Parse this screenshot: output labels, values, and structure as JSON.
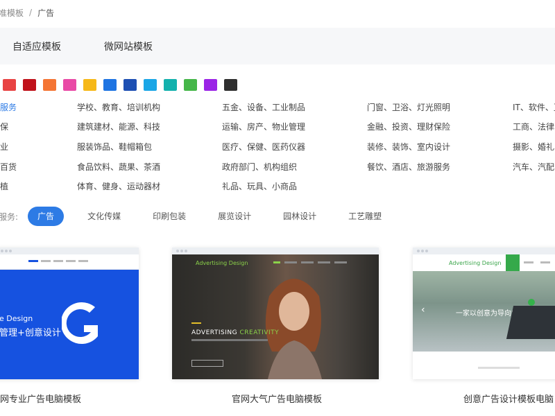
{
  "breadcrumb": {
    "parent": "准模板",
    "separator": "/",
    "current": "广告"
  },
  "tabs": [
    {
      "label": "自适应模板"
    },
    {
      "label": "微网站模板"
    }
  ],
  "colors": [
    "#e84343",
    "#c0121b",
    "#f47534",
    "#e94aa6",
    "#f6b818",
    "#1e74e2",
    "#1d4fb3",
    "#1aa6e6",
    "#13b1ad",
    "#45b649",
    "#9b24e6",
    "#2f2f2f"
  ],
  "categories": {
    "rows": [
      [
        "服务",
        "学校、教育、培训机构",
        "五金、设备、工业制品",
        "门窗、卫浴、灯光照明",
        "IT、软件、互"
      ],
      [
        "保",
        "建筑建材、能源、科技",
        "运输、房产、物业管理",
        "金融、投资、理财保险",
        "工商、法律、"
      ],
      [
        "业",
        "服装饰品、鞋帽箱包",
        "医疗、保健、医药仪器",
        "装修、装饰、室内设计",
        "摄影、婚礼、"
      ],
      [
        "百货",
        "食品饮料、蔬果、茶酒",
        "政府部门、机构组织",
        "餐饮、酒店、旅游服务",
        "汽车、汽配、"
      ],
      [
        "植",
        "体育、健身、运动器材",
        "礼品、玩具、小商品",
        "",
        ""
      ]
    ]
  },
  "services": {
    "label": "服务:",
    "items": [
      "广告",
      "文化传媒",
      "印刷包装",
      "展览设计",
      "园林设计",
      "工艺雕塑"
    ]
  },
  "cards": [
    {
      "title": "网专业广告电脑模板",
      "hero_line1": "e Design",
      "hero_line2": "管理+创意设计"
    },
    {
      "title": "官网大气广告电脑模板",
      "brand": "Advertising Design",
      "tagline_a": "ADVERTISING",
      "tagline_b": "CREATIVITY"
    },
    {
      "title": "创意广告设计模板电脑",
      "brand": "Advertising Design",
      "hero_text": "一家以创意为导向的广告公司"
    }
  ]
}
